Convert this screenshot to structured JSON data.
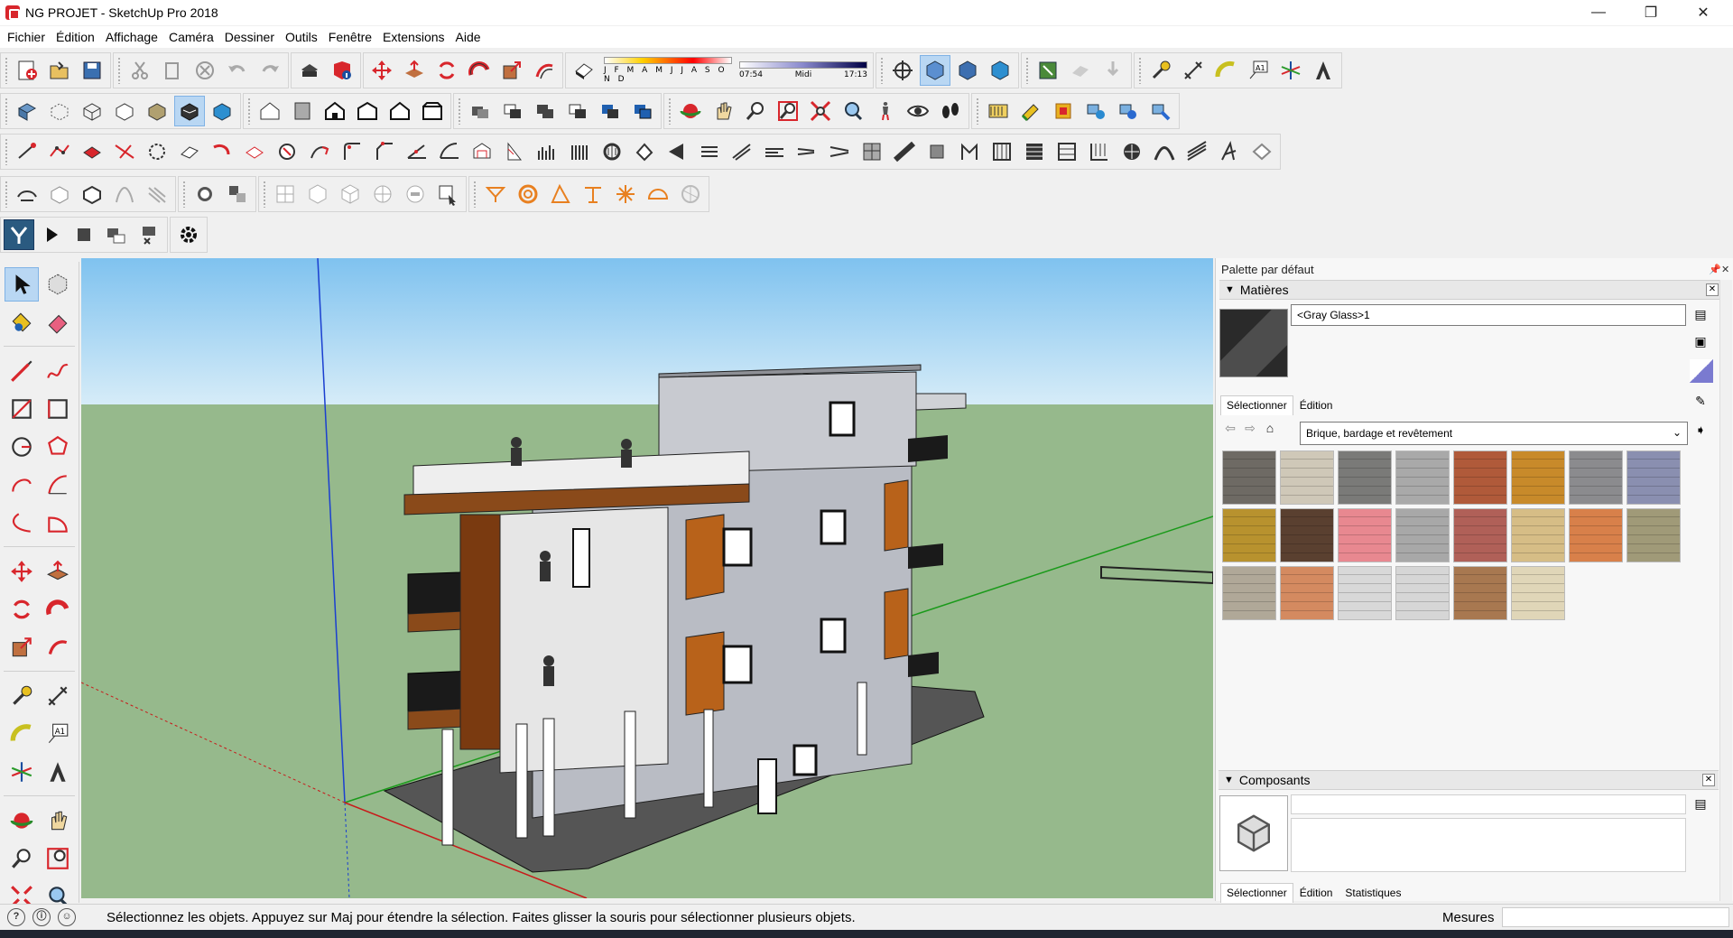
{
  "window": {
    "title": "NG PROJET - SketchUp Pro 2018",
    "minimize": "—",
    "maximize": "❐",
    "close": "✕"
  },
  "menu": [
    "Fichier",
    "Édition",
    "Affichage",
    "Caméra",
    "Dessiner",
    "Outils",
    "Fenêtre",
    "Extensions",
    "Aide"
  ],
  "shadow_widget": {
    "months": "J F M A M J J A S O N D",
    "time_start": "07:54",
    "time_mid": "Midi",
    "time_end": "17:13"
  },
  "tray": {
    "title": "Palette par défaut",
    "materials": {
      "heading": "Matières",
      "current_name": "<Gray Glass>1",
      "tab_select": "Sélectionner",
      "tab_edit": "Édition",
      "collection": "Brique, bardage et revêtement",
      "swatch_colors": [
        "#6e6a64",
        "#cfc8b8",
        "#7a7a78",
        "#a9a9a9",
        "#b05a3a",
        "#c88a2a",
        "#8b8b8e",
        "#8a8fb0",
        "#b8922e",
        "#5a4030",
        "#e88890",
        "#a8a8a8",
        "#b06058",
        "#d6bd86",
        "#d8804a",
        "#a09a78",
        "#b0a898",
        "#d48a60",
        "#d8d8d8",
        "#d6d6d6",
        "#a87850",
        "#e0d6b8"
      ]
    },
    "components": {
      "heading": "Composants",
      "tab_select": "Sélectionner",
      "tab_edit": "Édition",
      "tab_stats": "Statistiques"
    }
  },
  "status": {
    "message": "Sélectionnez les objets. Appuyez sur Maj pour étendre la sélection. Faites glisser la souris pour sélectionner plusieurs objets.",
    "measure_label": "Mesures",
    "icons": [
      "geo-location-icon",
      "credits-icon",
      "user-icon"
    ]
  }
}
